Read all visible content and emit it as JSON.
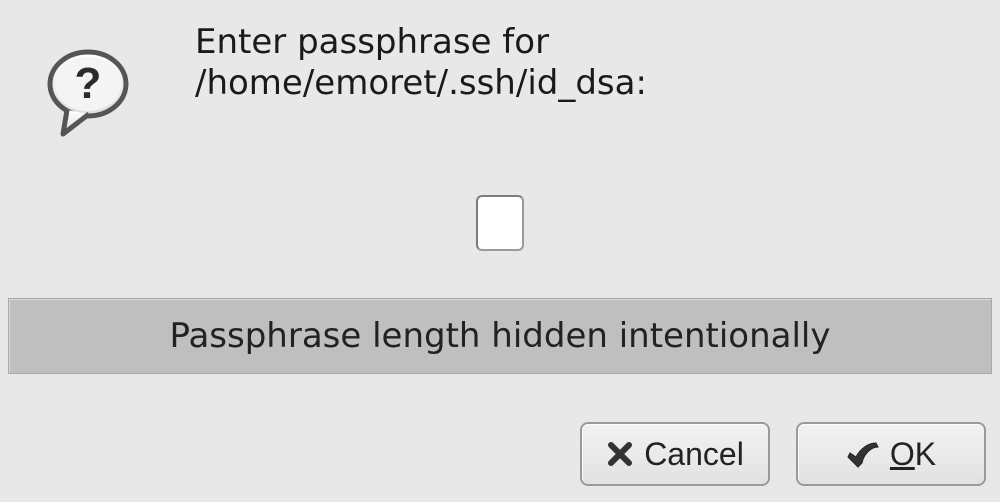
{
  "dialog": {
    "prompt": "Enter passphrase for /home/emoret/.ssh/id_dsa:",
    "passphrase_value": "",
    "hint": "Passphrase length hidden intentionally"
  },
  "buttons": {
    "cancel": "Cancel",
    "ok_prefix": "",
    "ok_mnemonic": "O",
    "ok_suffix": "K"
  },
  "icons": {
    "question": "question-bubble-icon",
    "cancel": "cancel-icon",
    "ok": "ok-apply-icon"
  }
}
